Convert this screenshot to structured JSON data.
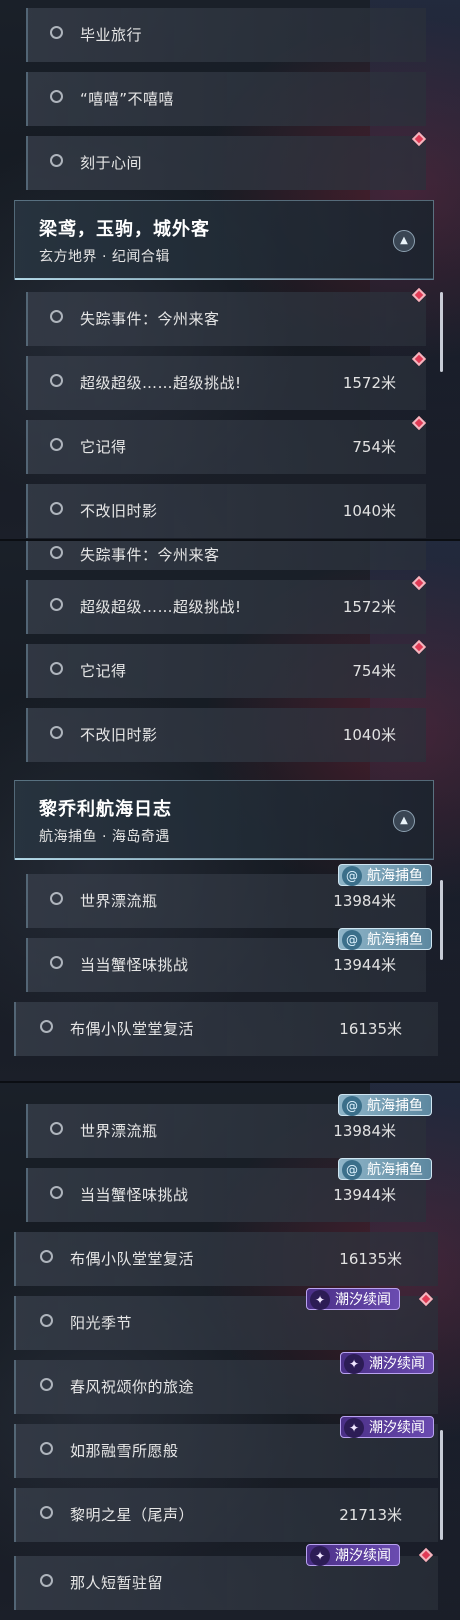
{
  "sections": [
    {
      "title": "梁鸢，玉驹，城外客",
      "subtitle": "玄方地界 · 纪闻合辑",
      "collapse_icon": "chevron-up-icon"
    },
    {
      "title": "黎乔利航海日志",
      "subtitle": "航海捕鱼 · 海岛奇遇",
      "collapse_icon": "chevron-up-icon"
    }
  ],
  "panel1": {
    "top_rows": [
      "毕业旅行",
      "“嘻嘻”不嘻嘻",
      "刻于心间"
    ],
    "rows": [
      {
        "label": "失踪事件：今州来客",
        "distance": ""
      },
      {
        "label": "超级超级……超级挑战!",
        "distance": "1572米"
      },
      {
        "label": "它记得",
        "distance": "754米"
      },
      {
        "label": "不改旧时影",
        "distance": "1040米"
      }
    ]
  },
  "panel2": {
    "rows": [
      {
        "label": "失踪事件：今州来客",
        "distance": ""
      },
      {
        "label": "超级超级……超级挑战!",
        "distance": "1572米"
      },
      {
        "label": "它记得",
        "distance": "754米"
      },
      {
        "label": "不改旧时影",
        "distance": "1040米"
      }
    ],
    "rows_after": [
      {
        "label": "世界漂流瓶",
        "distance": "13984米"
      },
      {
        "label": "当当蟹怪味挑战",
        "distance": "13944米"
      },
      {
        "label": "布偶小队堂堂复活",
        "distance": "16135米"
      }
    ]
  },
  "panel3": {
    "rows": [
      {
        "label": "世界漂流瓶",
        "distance": "13984米"
      },
      {
        "label": "当当蟹怪味挑战",
        "distance": "13944米"
      },
      {
        "label": "布偶小队堂堂复活",
        "distance": "16135米"
      },
      {
        "label": "阳光季节",
        "distance": ""
      },
      {
        "label": "春风祝颂你的旅途",
        "distance": ""
      },
      {
        "label": "如那融雪所愿般",
        "distance": ""
      },
      {
        "label": "黎明之星（尾声）",
        "distance": "21713米"
      },
      {
        "label": "那人短暂驻留",
        "distance": ""
      }
    ]
  },
  "tags": {
    "fishing": "航海捕鱼",
    "tide": "潮汐续闻"
  },
  "icons": {
    "tracking_marker": "red-diamond-icon",
    "fishing_tag": "fish-spiral-icon",
    "tide_tag": "feather-icon",
    "quest_status": "circle-outline-icon"
  },
  "colors": {
    "marker_red": "#e03a55",
    "fishing_tag": "#8fb5c8",
    "tide_tag": "#5a3d9e"
  }
}
